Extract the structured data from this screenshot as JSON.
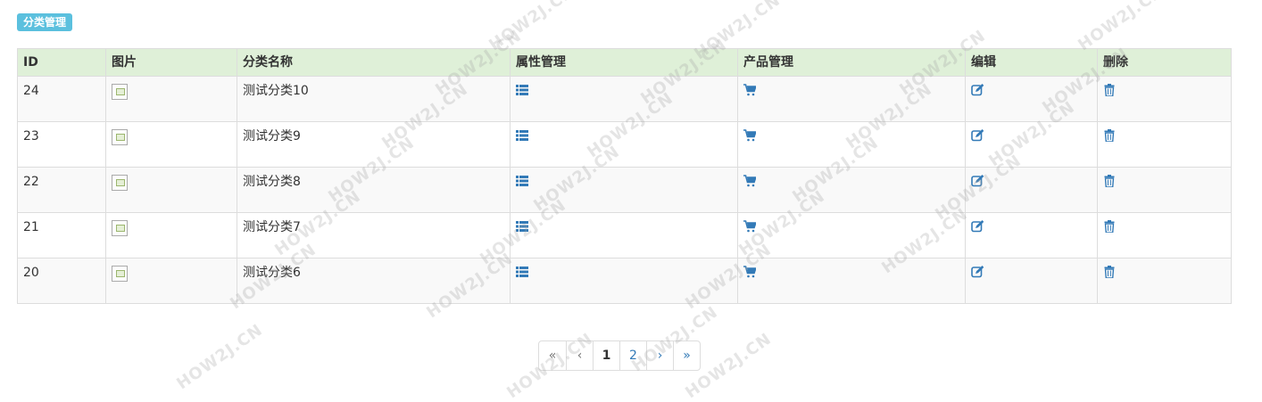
{
  "header": {
    "badge": "分类管理"
  },
  "table": {
    "columns": [
      "ID",
      "图片",
      "分类名称",
      "属性管理",
      "产品管理",
      "编辑",
      "删除"
    ],
    "rows": [
      {
        "id": "24",
        "name": "测试分类10"
      },
      {
        "id": "23",
        "name": "测试分类9"
      },
      {
        "id": "22",
        "name": "测试分类8"
      },
      {
        "id": "21",
        "name": "测试分类7"
      },
      {
        "id": "20",
        "name": "测试分类6"
      }
    ]
  },
  "icons": {
    "property": "list-icon",
    "product": "cart-icon",
    "edit": "edit-icon",
    "delete": "trash-icon",
    "image": "broken-image-icon"
  },
  "pagination": {
    "first": "«",
    "prev": "‹",
    "page1": "1",
    "page2": "2",
    "next": "›",
    "last": "»"
  },
  "watermark": {
    "text": "HOW2J.CN"
  },
  "colors": {
    "accent": "#337ab7",
    "header_bg": "#dff0d8",
    "badge_bg": "#5bc0de",
    "stripe": "#f9f9f9"
  }
}
